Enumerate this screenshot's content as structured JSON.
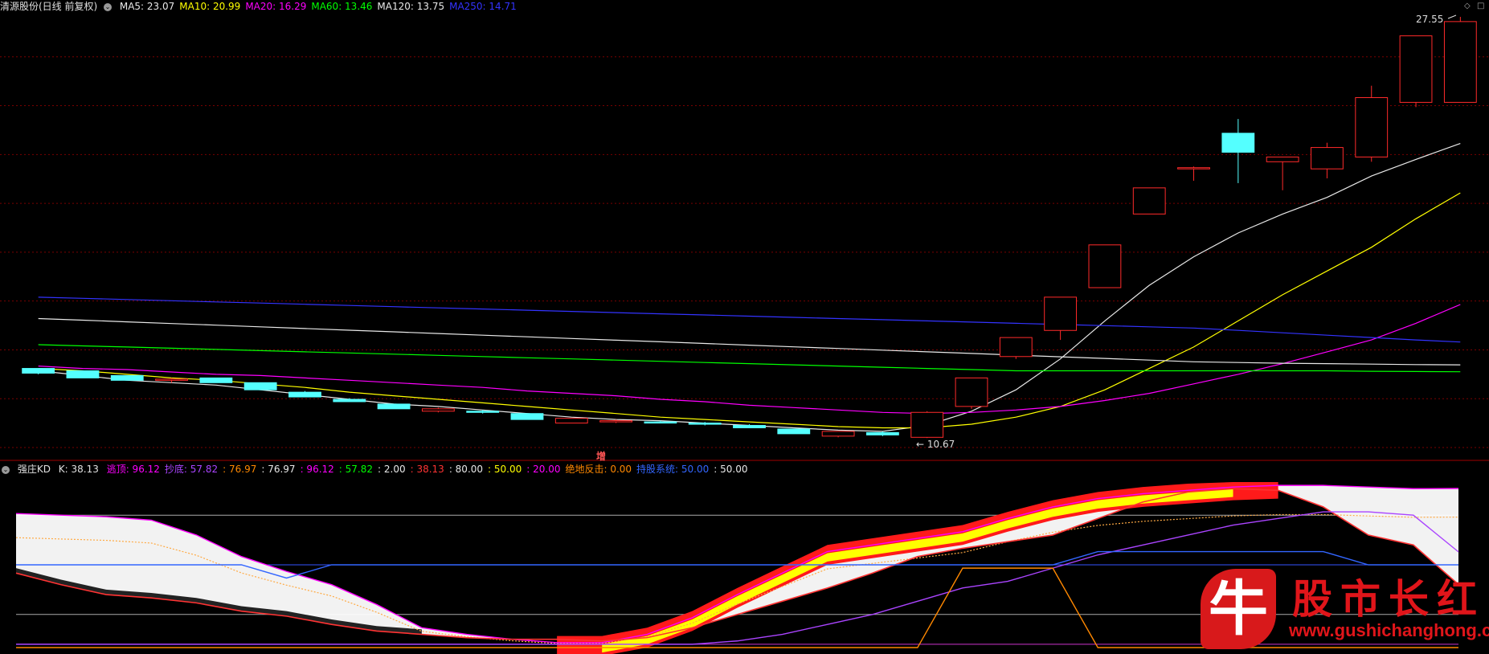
{
  "main_header": {
    "title": "清源股份(日线 前复权)",
    "items": [
      {
        "text": "MA5: 23.07",
        "color": "#e8e8e8"
      },
      {
        "text": "MA10: 20.99",
        "color": "#ffff00"
      },
      {
        "text": "MA20: 16.29",
        "color": "#ff00ff"
      },
      {
        "text": "MA60: 13.46",
        "color": "#00ff00"
      },
      {
        "text": "MA120: 13.75",
        "color": "#e8e8e8"
      },
      {
        "text": "MA250: 14.71",
        "color": "#3333ff"
      }
    ]
  },
  "sub_header": {
    "title": "强庄KD",
    "k_label": "K: 38.13",
    "items": [
      {
        "text": "逃顶: 96.12",
        "color": "#ff00ff"
      },
      {
        "text": "抄底: 57.82",
        "color": "#aa44ff"
      },
      {
        "text": ": 76.97",
        "color": "#ff8800"
      },
      {
        "text": ": 76.97",
        "color": "#e8e8e8"
      },
      {
        "text": ": 96.12",
        "color": "#ff00ff"
      },
      {
        "text": ": 57.82",
        "color": "#00ff00"
      },
      {
        "text": ": 2.00",
        "color": "#e8e8e8"
      },
      {
        "text": ": 38.13",
        "color": "#ff3333"
      },
      {
        "text": ": 80.00",
        "color": "#e8e8e8"
      },
      {
        "text": ": 50.00",
        "color": "#ffff00"
      },
      {
        "text": ": 20.00",
        "color": "#ff00ff"
      },
      {
        "text": "绝地反击: 0.00",
        "color": "#ff8800"
      },
      {
        "text": "持股系统: 50.00",
        "color": "#3366ff"
      },
      {
        "text": ": 50.00",
        "color": "#e8e8e8"
      }
    ]
  },
  "annotations": {
    "high": "27.55",
    "low": "10.67",
    "signal": "增"
  },
  "icons": {
    "toggle": "collapse-icon",
    "corner_left": "diamond-icon",
    "corner_right": "window-icon"
  },
  "watermark": {
    "logo_char": "牛",
    "name": "股市长红",
    "url": "www.gushichanghong.com"
  },
  "chart_data": [
    {
      "type": "candlestick",
      "title": "清源股份(日线 前复权)",
      "xlabel": "",
      "ylabel": "",
      "ylim": [
        10,
        28.5
      ],
      "grid": true,
      "candles": [
        [
          13.6,
          13.4,
          13.55,
          13.35
        ],
        [
          13.5,
          13.2,
          13.5,
          13.2
        ],
        [
          13.3,
          13.1,
          13.3,
          13.1
        ],
        [
          13.1,
          13.15,
          13.2,
          13.0
        ],
        [
          13.2,
          13.0,
          13.2,
          13.0
        ],
        [
          13.0,
          12.7,
          13.0,
          12.7
        ],
        [
          12.6,
          12.4,
          12.65,
          12.4
        ],
        [
          12.3,
          12.2,
          12.35,
          12.2
        ],
        [
          12.1,
          11.9,
          12.1,
          11.9
        ],
        [
          11.8,
          11.9,
          11.95,
          11.75
        ],
        [
          11.8,
          11.75,
          11.85,
          11.7
        ],
        [
          11.7,
          11.45,
          11.7,
          11.45
        ],
        [
          11.3,
          11.5,
          11.5,
          11.3
        ],
        [
          11.35,
          11.4,
          11.45,
          11.3
        ],
        [
          11.35,
          11.3,
          11.4,
          11.3
        ],
        [
          11.3,
          11.25,
          11.35,
          11.2
        ],
        [
          11.2,
          11.1,
          11.25,
          11.1
        ],
        [
          11.05,
          10.85,
          11.05,
          10.85
        ],
        [
          10.75,
          10.95,
          10.95,
          10.7
        ],
        [
          10.9,
          10.8,
          10.95,
          10.75
        ],
        [
          10.7,
          11.75,
          11.8,
          10.67
        ],
        [
          12.0,
          13.2,
          13.2,
          11.9
        ],
        [
          14.1,
          14.9,
          14.9,
          14.0
        ],
        [
          15.2,
          16.6,
          16.6,
          14.8
        ],
        [
          17.0,
          18.8,
          18.8,
          17.0
        ],
        [
          20.1,
          21.2,
          21.2,
          20.1
        ],
        [
          22.0,
          22.05,
          22.1,
          21.5
        ],
        [
          23.5,
          22.7,
          24.1,
          21.4
        ],
        [
          22.3,
          22.5,
          22.5,
          21.1
        ],
        [
          22.0,
          22.9,
          23.1,
          21.6
        ],
        [
          22.5,
          25.0,
          25.5,
          22.3
        ],
        [
          24.8,
          27.6,
          27.6,
          24.6
        ],
        [
          24.8,
          28.2,
          28.4,
          24.8
        ]
      ],
      "series": [
        {
          "name": "MA5",
          "color": "#e8e8e8"
        },
        {
          "name": "MA10",
          "color": "#ffff00"
        },
        {
          "name": "MA20",
          "color": "#ff00ff"
        },
        {
          "name": "MA60",
          "color": "#00ff00"
        },
        {
          "name": "MA120",
          "color": "#e8e8e8"
        },
        {
          "name": "MA250",
          "color": "#3333ff"
        }
      ],
      "ma_lines": {
        "MA5": [
          13.5,
          13.3,
          13.1,
          13.0,
          12.9,
          12.7,
          12.5,
          12.3,
          12.1,
          12.0,
          11.85,
          11.7,
          11.55,
          11.45,
          11.4,
          11.3,
          11.2,
          11.1,
          11.0,
          10.95,
          11.2,
          11.8,
          12.7,
          14.0,
          15.6,
          17.1,
          18.3,
          19.3,
          20.1,
          20.8,
          21.7,
          22.4,
          23.07
        ],
        "MA10": [
          13.6,
          13.5,
          13.35,
          13.2,
          13.1,
          12.95,
          12.8,
          12.6,
          12.45,
          12.3,
          12.15,
          12.0,
          11.85,
          11.7,
          11.55,
          11.45,
          11.35,
          11.25,
          11.15,
          11.1,
          11.1,
          11.25,
          11.55,
          12.0,
          12.7,
          13.6,
          14.5,
          15.6,
          16.7,
          17.7,
          18.7,
          19.9,
          20.99
        ],
        "MA20": [
          13.7,
          13.6,
          13.55,
          13.45,
          13.35,
          13.3,
          13.2,
          13.1,
          13.0,
          12.9,
          12.8,
          12.65,
          12.55,
          12.45,
          12.3,
          12.2,
          12.05,
          11.95,
          11.85,
          11.75,
          11.7,
          11.75,
          11.85,
          12.0,
          12.25,
          12.55,
          12.95,
          13.35,
          13.8,
          14.3,
          14.8,
          15.5,
          16.29
        ],
        "MA60": [
          14.6,
          14.55,
          14.5,
          14.45,
          14.4,
          14.35,
          14.3,
          14.25,
          14.2,
          14.15,
          14.1,
          14.05,
          14.0,
          13.95,
          13.9,
          13.85,
          13.8,
          13.75,
          13.7,
          13.65,
          13.6,
          13.55,
          13.5,
          13.5,
          13.5,
          13.5,
          13.5,
          13.5,
          13.5,
          13.5,
          13.48,
          13.47,
          13.46
        ],
        "MA120": [
          15.7,
          15.63,
          15.56,
          15.49,
          15.42,
          15.35,
          15.28,
          15.21,
          15.14,
          15.07,
          15.0,
          14.93,
          14.86,
          14.79,
          14.72,
          14.65,
          14.58,
          14.51,
          14.44,
          14.37,
          14.3,
          14.23,
          14.16,
          14.09,
          14.02,
          13.95,
          13.88,
          13.85,
          13.82,
          13.8,
          13.78,
          13.76,
          13.75
        ],
        "MA250": [
          16.6,
          16.55,
          16.5,
          16.45,
          16.4,
          16.35,
          16.3,
          16.25,
          16.2,
          16.15,
          16.1,
          16.05,
          16.0,
          15.95,
          15.9,
          15.85,
          15.8,
          15.75,
          15.7,
          15.65,
          15.6,
          15.55,
          15.5,
          15.45,
          15.4,
          15.35,
          15.3,
          15.2,
          15.1,
          15.0,
          14.9,
          14.8,
          14.71
        ]
      }
    },
    {
      "type": "line",
      "title": "强庄KD",
      "xlabel": "",
      "ylabel": "",
      "ylim": [
        0,
        100
      ],
      "levels": [
        80,
        50,
        20,
        2
      ],
      "series": [
        {
          "name": "逃顶",
          "color": "#ff00ff",
          "values": [
            81,
            80,
            79,
            77,
            68,
            55,
            46,
            38,
            26,
            12,
            8,
            5,
            3,
            3,
            8,
            18,
            32,
            45,
            58,
            62,
            66,
            70,
            78,
            85,
            90,
            93,
            95,
            97,
            98,
            98,
            97,
            96,
            96.12
          ]
        },
        {
          "name": "K",
          "color": "#ff3333",
          "values": [
            45,
            38,
            32,
            30,
            27,
            22,
            19,
            14,
            10,
            8,
            6,
            5,
            5,
            4,
            6,
            12,
            20,
            28,
            36,
            45,
            55,
            60,
            64,
            68,
            78,
            88,
            94,
            96,
            95,
            85,
            68,
            62,
            38.13
          ]
        },
        {
          "name": "抄底",
          "color": "#aa44ff",
          "values": [
            2,
            2,
            2,
            2,
            2,
            2,
            2,
            2,
            2,
            2,
            2,
            2,
            2,
            2,
            2,
            2,
            4,
            8,
            14,
            20,
            28,
            36,
            40,
            48,
            56,
            62,
            68,
            74,
            78,
            82,
            82,
            80,
            57.82
          ]
        },
        {
          "name": "绝地反击",
          "color": "#ff8800",
          "values": [
            0,
            0,
            0,
            0,
            0,
            0,
            0,
            0,
            0,
            0,
            0,
            0,
            0,
            0,
            0,
            0,
            0,
            0,
            0,
            0,
            0,
            48,
            48,
            48,
            0,
            0,
            0,
            0,
            0,
            0,
            0,
            0,
            0.0
          ]
        },
        {
          "name": "持股系统",
          "color": "#3366ff",
          "values": [
            50,
            50,
            50,
            50,
            50,
            50,
            42,
            50,
            50,
            50,
            50,
            50,
            50,
            50,
            50,
            50,
            50,
            50,
            50,
            50,
            50,
            50,
            50,
            50,
            58,
            58,
            58,
            58,
            58,
            58,
            50,
            50,
            50.0
          ]
        }
      ]
    }
  ]
}
